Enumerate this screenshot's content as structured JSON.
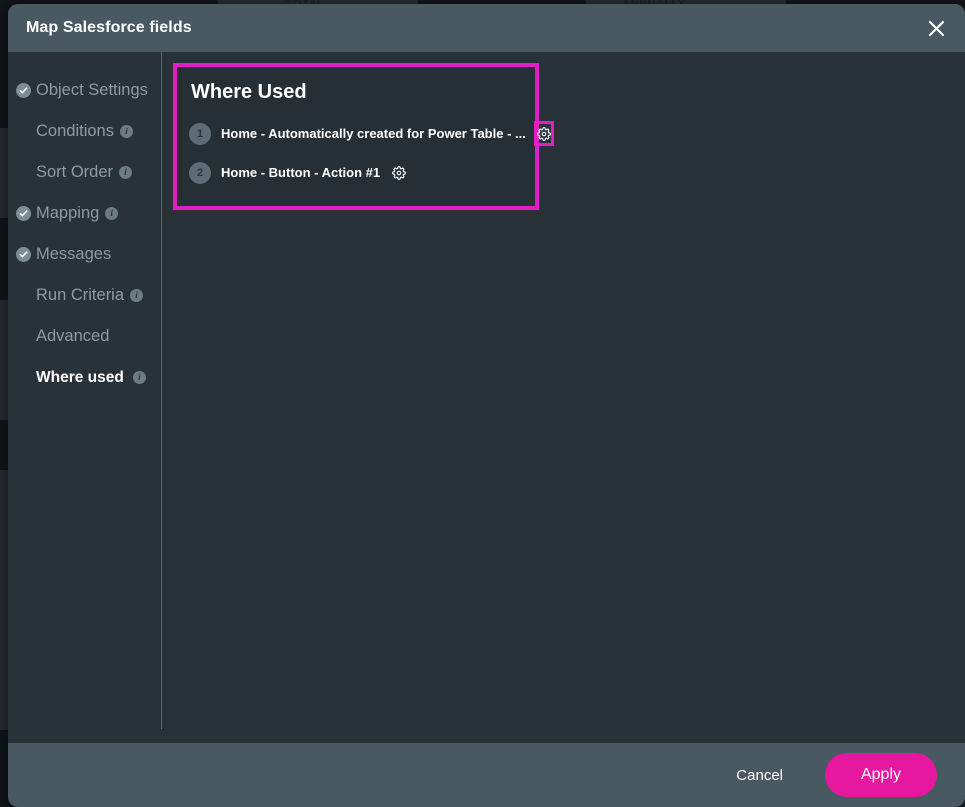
{
  "modal": {
    "title": "Map Salesforce fields",
    "close_icon": "close-icon"
  },
  "sidebar": {
    "items": [
      {
        "label": "Object Settings",
        "completed": true,
        "has_info": false,
        "active": false
      },
      {
        "label": "Conditions",
        "completed": false,
        "has_info": true,
        "active": false
      },
      {
        "label": "Sort Order",
        "completed": false,
        "has_info": true,
        "active": false
      },
      {
        "label": "Mapping",
        "completed": true,
        "has_info": true,
        "active": false
      },
      {
        "label": "Messages",
        "completed": true,
        "has_info": false,
        "active": false
      },
      {
        "label": "Run Criteria",
        "completed": false,
        "has_info": true,
        "active": false
      },
      {
        "label": "Advanced",
        "completed": false,
        "has_info": false,
        "active": false
      },
      {
        "label": "Where used",
        "completed": false,
        "has_info": true,
        "active": true
      }
    ],
    "info_glyph": "i"
  },
  "where_used": {
    "title": "Where Used",
    "rows": [
      {
        "number": "1",
        "label": "Home - Automatically created for Power Table - ...",
        "gear_icon": "gear-icon",
        "gear_highlighted": true
      },
      {
        "number": "2",
        "label": "Home - Button - Action #1",
        "gear_icon": "gear-icon",
        "gear_highlighted": false
      }
    ]
  },
  "footer": {
    "cancel_label": "Cancel",
    "apply_label": "Apply"
  },
  "colors": {
    "accent_magenta": "#e31ec3",
    "apply_button": "#e5189f",
    "header_bar": "#495961",
    "body_background": "#283238"
  },
  "backdrop": {
    "ghost_labels": [
      "TOTAL",
      "ANNUALLY"
    ]
  }
}
